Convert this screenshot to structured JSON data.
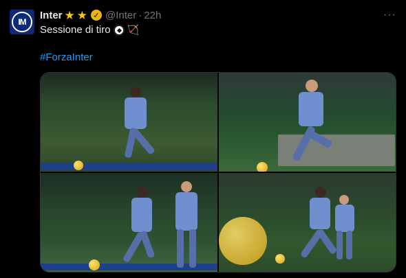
{
  "post": {
    "author_name": "Inter",
    "author_handle": "@Inter",
    "separator": "·",
    "timestamp": "22h",
    "avatar_text": "IM",
    "star_icon": "★",
    "more_icon": "···",
    "text": "Sessione di tiro",
    "hashtag": "#ForzaInter",
    "photos": [
      {
        "alt": "Sessione di tiro photo 1"
      },
      {
        "alt": "Sessione di tiro photo 2"
      },
      {
        "alt": "Sessione di tiro photo 3"
      },
      {
        "alt": "Sessione di tiro photo 4"
      }
    ]
  },
  "colors": {
    "background": "#000000",
    "text": "#e7e9ea",
    "muted": "#71767b",
    "link": "#1d9bf0",
    "verified": "#e7b416"
  }
}
